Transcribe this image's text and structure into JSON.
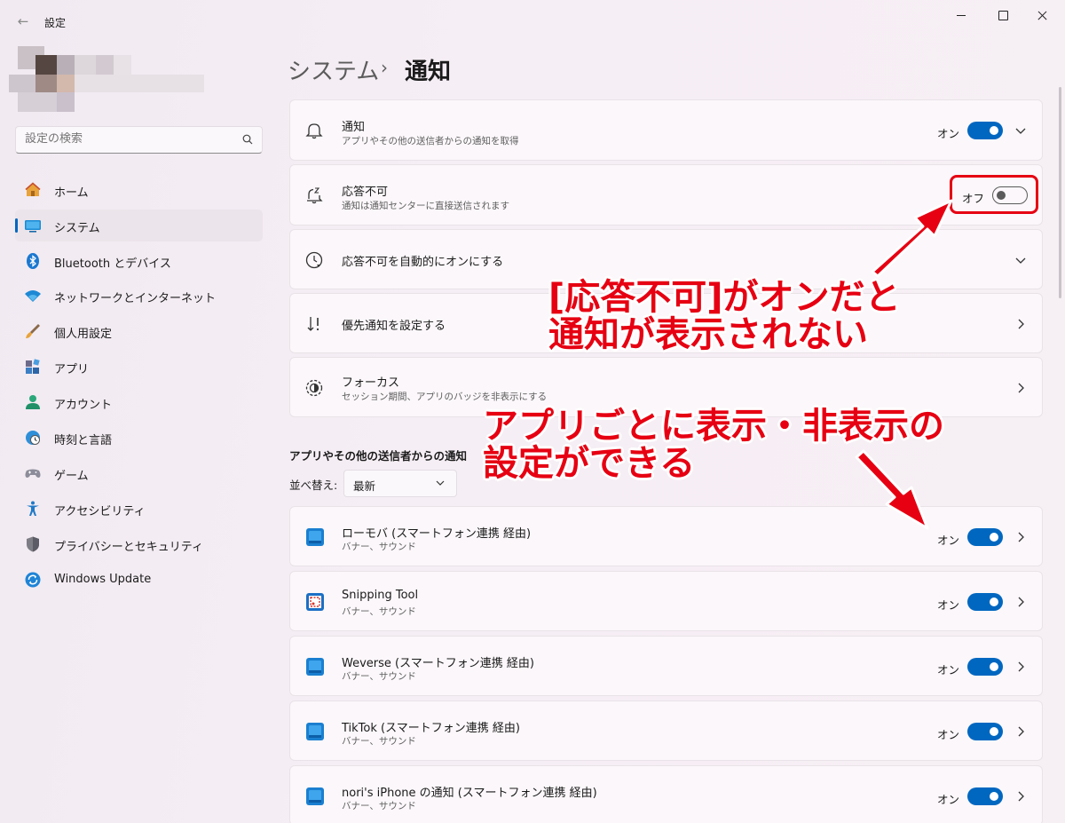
{
  "window": {
    "title": "設定"
  },
  "search": {
    "placeholder": "設定の検索"
  },
  "sidebar": {
    "items": [
      {
        "label": "ホーム",
        "icon": "home-icon"
      },
      {
        "label": "システム",
        "icon": "system-icon",
        "active": true
      },
      {
        "label": "Bluetooth とデバイス",
        "icon": "bluetooth-icon"
      },
      {
        "label": "ネットワークとインターネット",
        "icon": "wifi-icon"
      },
      {
        "label": "個人用設定",
        "icon": "brush-icon"
      },
      {
        "label": "アプリ",
        "icon": "apps-icon"
      },
      {
        "label": "アカウント",
        "icon": "account-icon"
      },
      {
        "label": "時刻と言語",
        "icon": "clock-globe-icon"
      },
      {
        "label": "ゲーム",
        "icon": "gamepad-icon"
      },
      {
        "label": "アクセシビリティ",
        "icon": "accessibility-icon"
      },
      {
        "label": "プライバシーとセキュリティ",
        "icon": "shield-icon"
      },
      {
        "label": "Windows Update",
        "icon": "update-icon"
      }
    ]
  },
  "breadcrumb": {
    "parent": "システム",
    "separator": "›",
    "current": "通知"
  },
  "settings": {
    "notifications": {
      "title": "通知",
      "subtitle": "アプリやその他の送信者からの通知を取得",
      "state": "オン"
    },
    "dnd": {
      "title": "応答不可",
      "subtitle": "通知は通知センターに直接送信されます",
      "state": "オフ"
    },
    "auto_dnd": {
      "title": "応答不可を自動的にオンにする"
    },
    "priority": {
      "title": "優先通知を設定する"
    },
    "focus": {
      "title": "フォーカス",
      "subtitle": "セッション期間、アプリのバッジを非表示にする"
    }
  },
  "apps_section": {
    "label": "アプリやその他の送信者からの通知",
    "sort_label": "並べ替え:",
    "sort_value": "最新",
    "items": [
      {
        "name": "ローモバ (スマートフォン連携 経由)",
        "detail": "バナー、サウンド",
        "state": "オン"
      },
      {
        "name": "Snipping Tool",
        "detail": "バナー、サウンド",
        "state": "オン"
      },
      {
        "name": "Weverse (スマートフォン連携 経由)",
        "detail": "バナー、サウンド",
        "state": "オン"
      },
      {
        "name": "TikTok (スマートフォン連携 経由)",
        "detail": "バナー、サウンド",
        "state": "オン"
      },
      {
        "name": "nori's iPhone の通知 (スマートフォン連携 経由)",
        "detail": "バナー、サウンド",
        "state": "オン"
      }
    ]
  },
  "annotations": {
    "dnd_note_line1": "[応答不可]がオンだと",
    "dnd_note_line2": "通知が表示されない",
    "app_note_line1": "アプリごとに表示・非表示の",
    "app_note_line2": "設定ができる"
  },
  "colors": {
    "accent": "#0067c0",
    "annotation": "#e60012"
  }
}
